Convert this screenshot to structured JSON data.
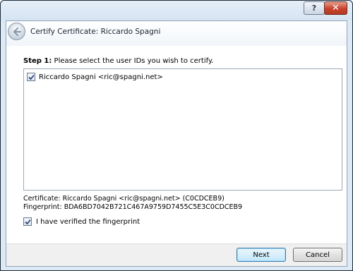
{
  "window": {
    "help_label": "?",
    "close_label": "✕",
    "title": "Certify Certificate: Riccardo Spagni"
  },
  "step": {
    "number": "Step 1:",
    "instruction": " Please select the user IDs you wish to certify."
  },
  "user_ids": [
    {
      "label": "Riccardo Spagni <ric@spagni.net>",
      "checked": true
    }
  ],
  "certificate": {
    "line": "Certificate: Riccardo Spagni <ric@spagni.net> (C0CDCEB9)",
    "fingerprint": "Fingerprint: BDA6BD7042B721C467A9759D7455C5E3C0CDCEB9"
  },
  "verify": {
    "label": "I have verified the fingerprint",
    "checked": true
  },
  "buttons": {
    "next": "Next",
    "cancel": "Cancel"
  },
  "icons": {
    "back": "back-arrow-icon",
    "check": "checkmark-icon"
  }
}
